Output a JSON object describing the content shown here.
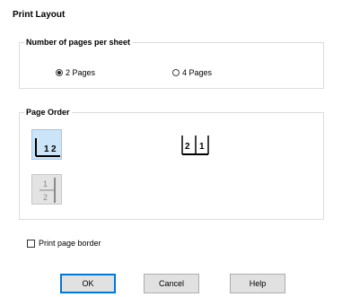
{
  "dialog": {
    "title": "Print Layout"
  },
  "pages_group": {
    "label": "Number of pages per sheet",
    "options": [
      {
        "label": "2 Pages",
        "checked": true
      },
      {
        "label": "4 Pages",
        "checked": false
      }
    ]
  },
  "page_order_group": {
    "label": "Page Order",
    "views": [
      {
        "icon": "left-to-right-order-icon",
        "selected": true,
        "enabled": true
      },
      {
        "icon": "right-to-left-order-icon",
        "selected": false,
        "enabled": true
      },
      {
        "icon": "top-to-bottom-order-icon",
        "selected": false,
        "enabled": false
      }
    ]
  },
  "print_page_border": {
    "label": "Print page border",
    "checked": false
  },
  "buttons": {
    "ok": "OK",
    "cancel": "Cancel",
    "help": "Help"
  },
  "colors": {
    "selected_bg": "#cce4f7",
    "selected_border": "#99c9ef",
    "default_button_border": "#0078d7"
  }
}
